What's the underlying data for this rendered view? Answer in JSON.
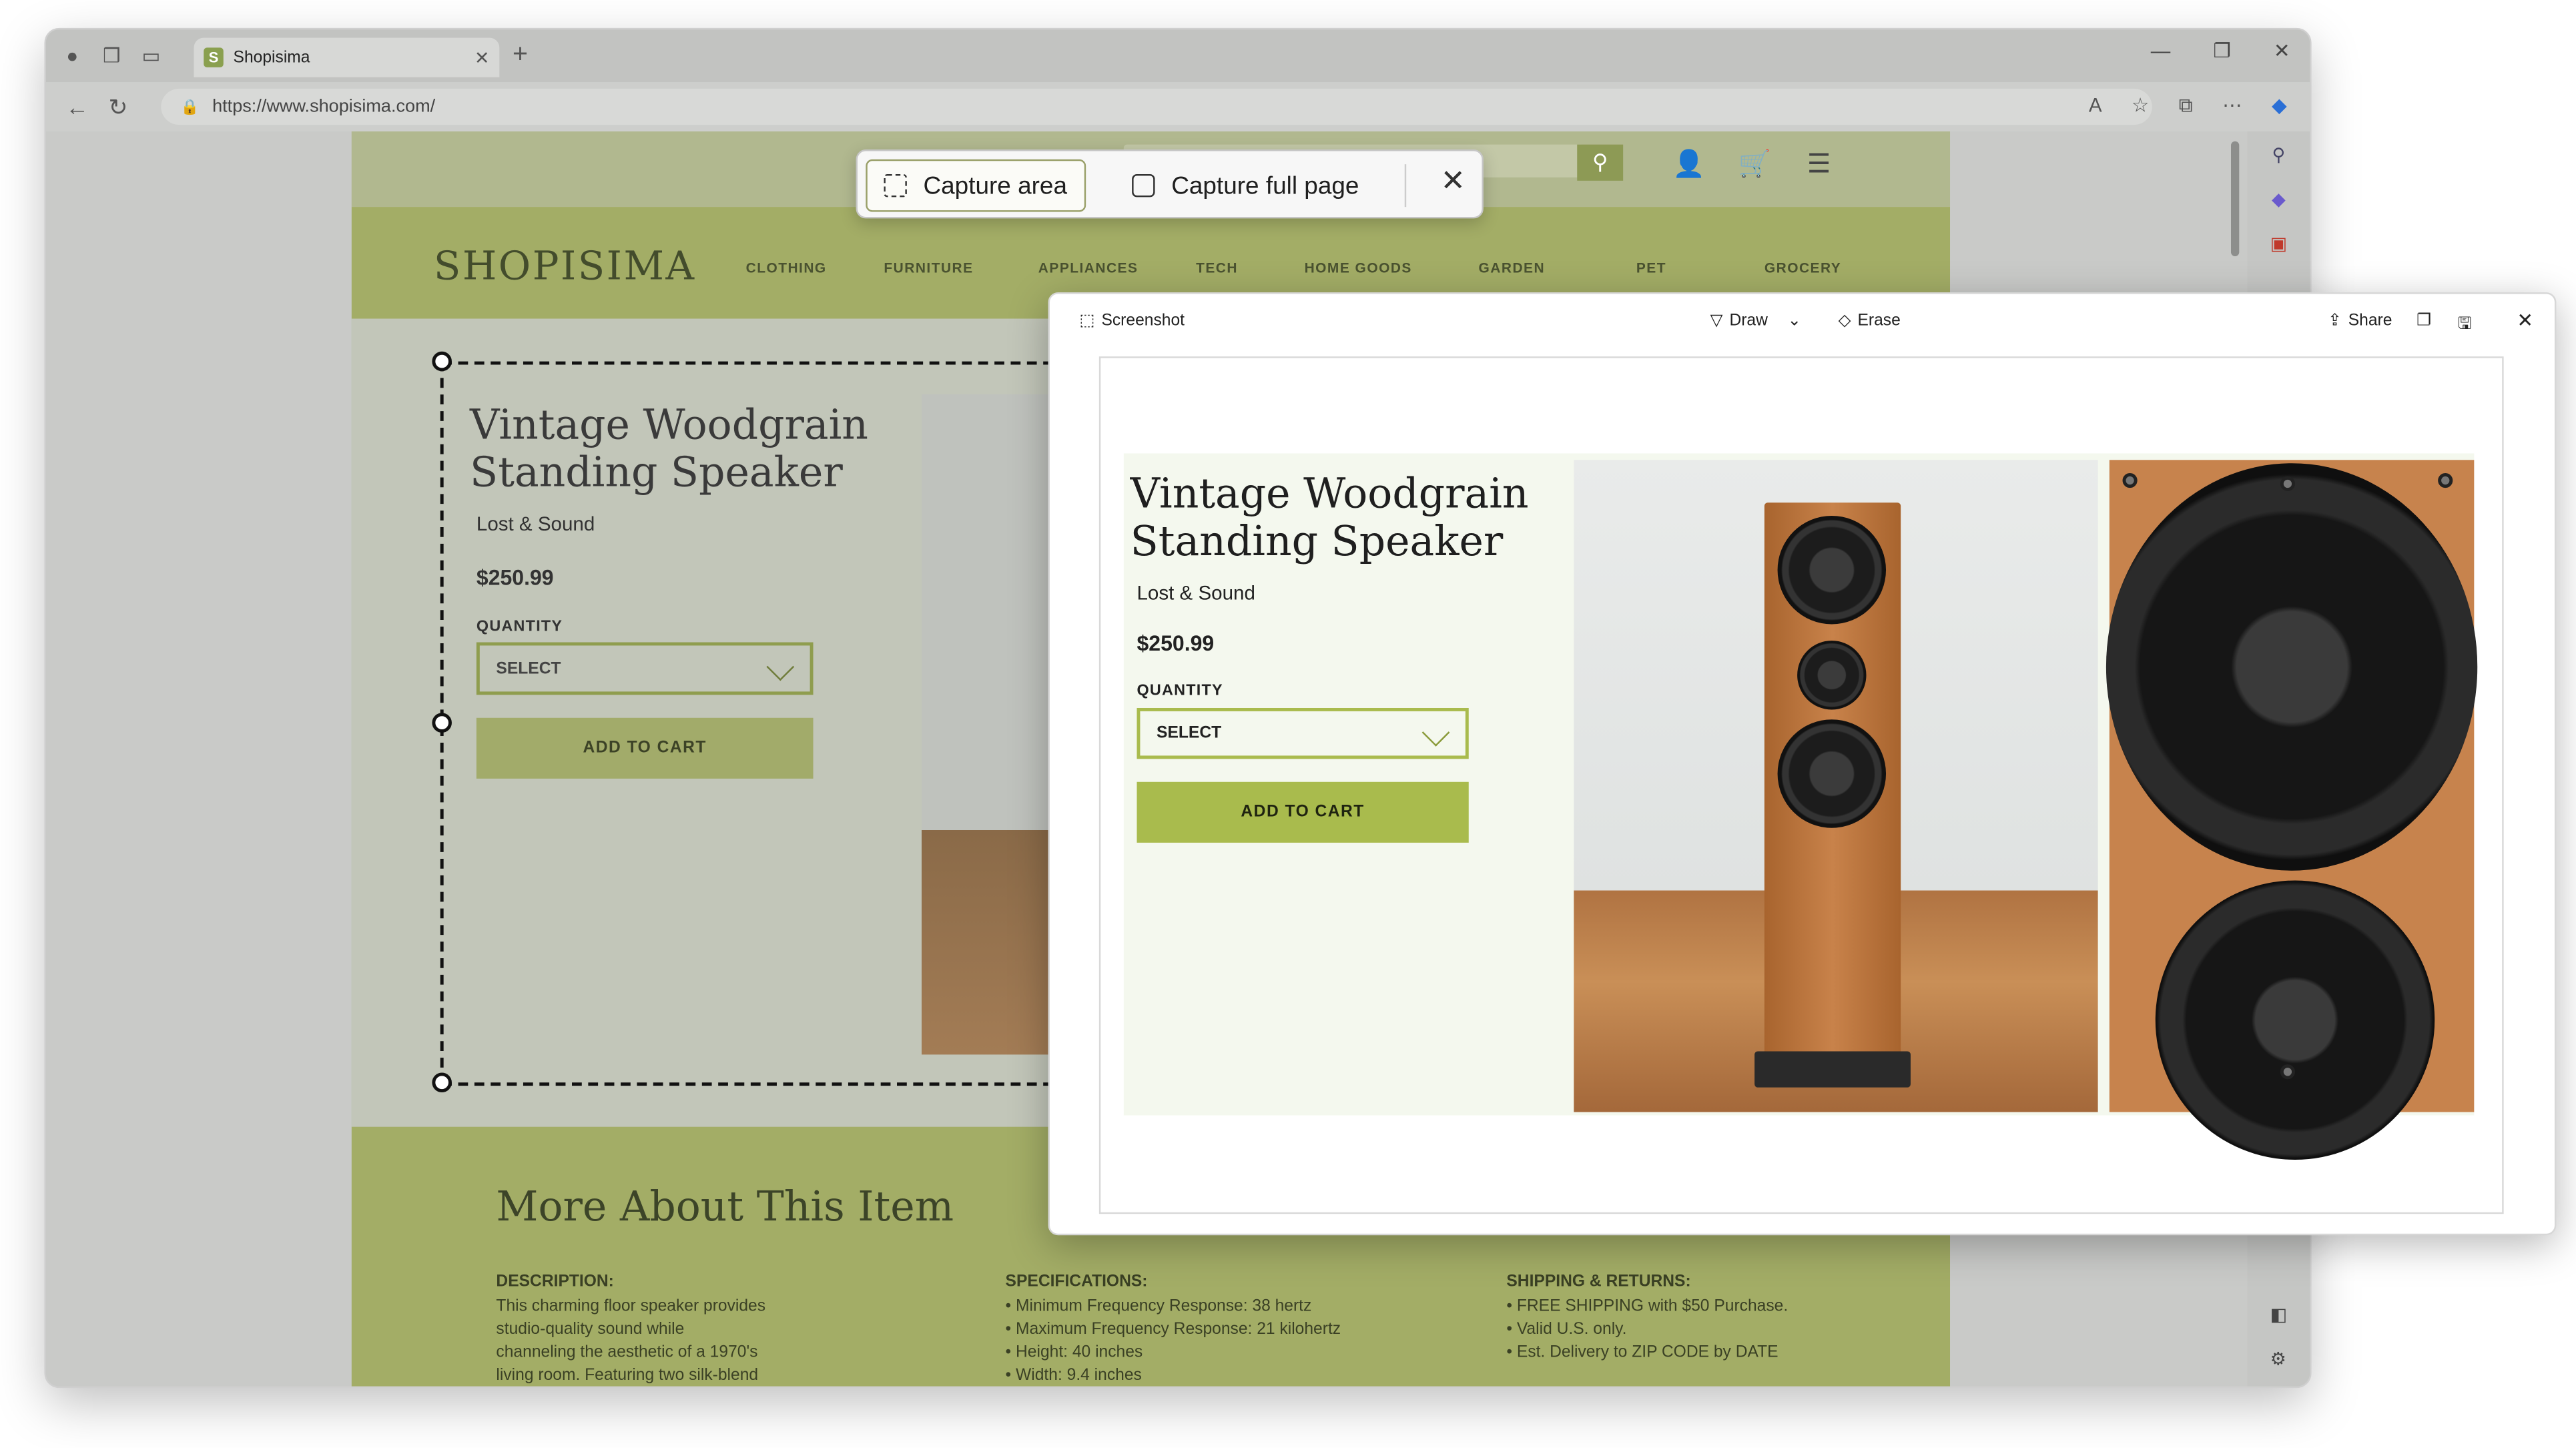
{
  "browser": {
    "tab_title": "Shopisima",
    "url": "https://www.shopisima.com/",
    "new_tab_icon": "plus-icon"
  },
  "site": {
    "logo": "SHOPISIMA",
    "menu": [
      "CLOTHING",
      "FURNITURE",
      "APPLIANCES",
      "TECH",
      "HOME GOODS",
      "GARDEN",
      "PET",
      "GROCERY"
    ],
    "product": {
      "title": "Vintage Woodgrain\nStanding Speaker",
      "brand": "Lost & Sound",
      "price": "$250.99",
      "quantity_label": "QUANTITY",
      "select_label": "SELECT",
      "add_to_cart": "ADD TO CART"
    },
    "more": {
      "heading": "More About This Item",
      "description_title": "DESCRIPTION:",
      "description_lines": [
        "This charming floor speaker provides",
        "studio-quality sound while",
        "channeling the aesthetic of a 1970's",
        "living room. Featuring two silk-blend"
      ],
      "spec_title": "SPECIFICATIONS:",
      "specs": [
        "Minimum Frequency Response: 38 hertz",
        "Maximum Frequency Response: 21 kilohertz",
        "Height: 40 inches",
        "Width: 9.4 inches"
      ],
      "ship_title": "SHIPPING & RETURNS:",
      "ship": [
        "FREE SHIPPING with $50 Purchase.",
        "Valid U.S. only.",
        "Est. Delivery to ZIP CODE by DATE"
      ]
    }
  },
  "capture_toolbar": {
    "capture_area": "Capture area",
    "capture_full_page": "Capture full page"
  },
  "screenshot_panel": {
    "title": "Screenshot",
    "draw": "Draw",
    "erase": "Erase",
    "share": "Share"
  },
  "colors": {
    "accent_green": "#a9bb4d",
    "dim_green": "#a3ad66"
  }
}
